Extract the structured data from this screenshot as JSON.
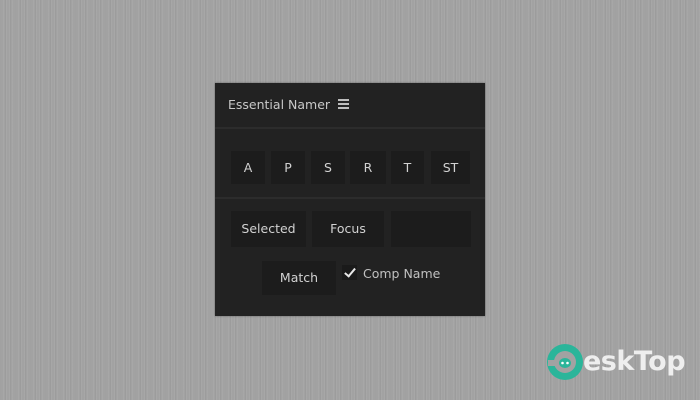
{
  "panel": {
    "title": "Essential Namer",
    "property_buttons": [
      "A",
      "P",
      "S",
      "R",
      "T",
      "ST"
    ],
    "scope_buttons": [
      "Selected",
      "Focus",
      ""
    ],
    "match_label": "Match",
    "comp_name_label": "Comp Name",
    "comp_name_checked": true
  },
  "watermark": {
    "text": "eskTop"
  },
  "colors": {
    "panel_bg": "#222222",
    "button_bg": "#1c1c1c",
    "page_bg": "#a2a2a2",
    "watermark_logo": "#2bb59a"
  }
}
